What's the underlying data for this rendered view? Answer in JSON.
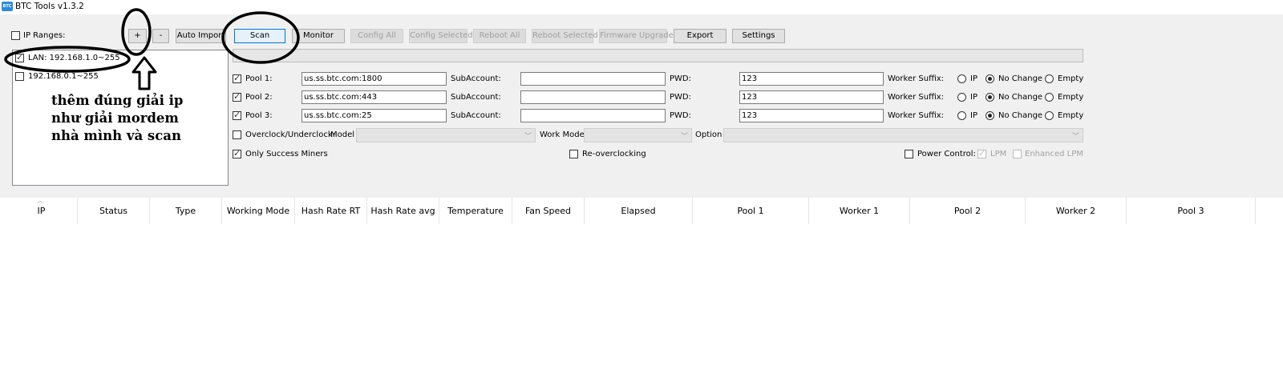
{
  "window": {
    "title": "BTC Tools v1.3.2",
    "logo_text": "BTC"
  },
  "ip_ranges": {
    "label": "IP Ranges:",
    "checked": false,
    "add_label": "+",
    "remove_label": "-",
    "items": [
      {
        "label": "LAN: 192.168.1.0~255",
        "checked": true
      },
      {
        "label": "192.168.0.1~255",
        "checked": false
      }
    ]
  },
  "toolbar": {
    "auto_import": "Auto Import",
    "scan": "Scan",
    "monitor": "Monitor",
    "config_all": "Config All",
    "config_selected": "Config Selected",
    "reboot_all": "Reboot All",
    "reboot_selected": "Reboot Selected",
    "firmware_upgrade": "Firmware Upgrade",
    "export": "Export",
    "settings": "Settings"
  },
  "progress": 0,
  "pools": [
    {
      "label": "Pool 1:",
      "checked": true,
      "url": "us.ss.btc.com:1800",
      "subaccount_label": "SubAccount:",
      "subaccount": "",
      "pwd_label": "PWD:",
      "pwd": "123",
      "suffix_label": "Worker Suffix:",
      "options": [
        "IP",
        "No Change",
        "Empty"
      ],
      "selected": "No Change"
    },
    {
      "label": "Pool 2:",
      "checked": true,
      "url": "us.ss.btc.com:443",
      "subaccount_label": "SubAccount:",
      "subaccount": "",
      "pwd_label": "PWD:",
      "pwd": "123",
      "suffix_label": "Worker Suffix:",
      "options": [
        "IP",
        "No Change",
        "Empty"
      ],
      "selected": "No Change"
    },
    {
      "label": "Pool 3:",
      "checked": true,
      "url": "us.ss.btc.com:25",
      "subaccount_label": "SubAccount:",
      "subaccount": "",
      "pwd_label": "PWD:",
      "pwd": "123",
      "suffix_label": "Worker Suffix:",
      "options": [
        "IP",
        "No Change",
        "Empty"
      ],
      "selected": "No Change"
    }
  ],
  "overclock": {
    "label": "Overclock/Underclock:",
    "checked": false,
    "model_label": "Model",
    "work_mode_label": "Work Mode",
    "option_label": "Option"
  },
  "only_success": {
    "label": "Only Success Miners",
    "checked": true
  },
  "re_overclocking": {
    "label": "Re-overclocking",
    "checked": false
  },
  "power_control": {
    "label": "Power Control:",
    "checked": false,
    "lpm_label": "LPM",
    "lpm_checked": true,
    "enhanced_lpm_label": "Enhanced LPM",
    "enhanced_lpm_checked": false
  },
  "table": {
    "columns": [
      "IP",
      "Status",
      "Type",
      "Working Mode",
      "Hash Rate RT",
      "Hash Rate avg",
      "Temperature",
      "Fan Speed",
      "Elapsed",
      "Pool 1",
      "Worker 1",
      "Pool 2",
      "Worker 2",
      "Pool 3"
    ],
    "rows": []
  },
  "annotation": {
    "lines": [
      "thêm đúng giải ip",
      "như giải mordem",
      "nhà mình và scan"
    ],
    "color": "#000000"
  }
}
